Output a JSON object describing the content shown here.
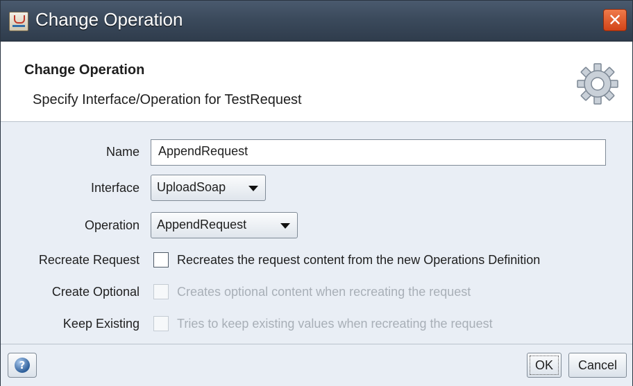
{
  "window": {
    "title": "Change Operation"
  },
  "header": {
    "title": "Change Operation",
    "subtitle": "Specify Interface/Operation for TestRequest"
  },
  "form": {
    "name_label": "Name",
    "name_value": "AppendRequest",
    "interface_label": "Interface",
    "interface_value": "UploadSoap",
    "operation_label": "Operation",
    "operation_value": "AppendRequest",
    "recreate_label": "Recreate Request",
    "recreate_text": "Recreates the request content from the new Operations Definition",
    "optional_label": "Create Optional",
    "optional_text": "Creates optional content when recreating the request",
    "keep_label": "Keep Existing",
    "keep_text": "Tries to keep existing values when recreating the request"
  },
  "footer": {
    "ok_label": "OK",
    "cancel_label": "Cancel"
  },
  "icons": {
    "app": "java-cup-icon",
    "close": "close-icon",
    "header": "gear-icon",
    "help": "help-icon"
  }
}
